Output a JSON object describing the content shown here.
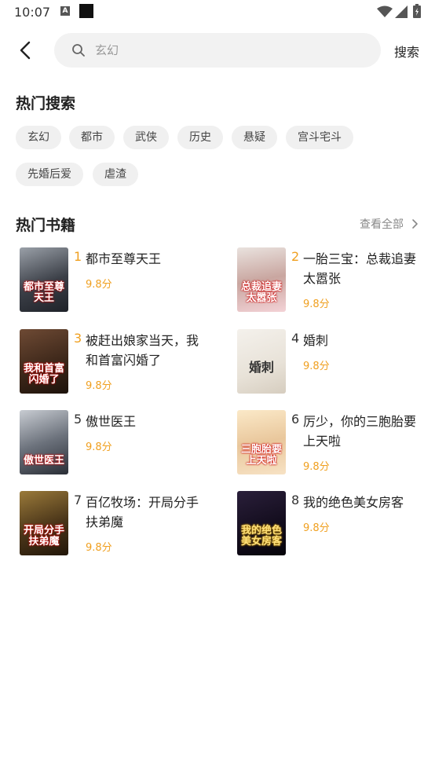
{
  "status_bar": {
    "time": "10:07",
    "notif_icon_letter": "A"
  },
  "header": {
    "search_placeholder": "玄幻",
    "search_button": "搜索"
  },
  "hot_search": {
    "title": "热门搜索",
    "tags": [
      "玄幻",
      "都市",
      "武侠",
      "历史",
      "悬疑",
      "宫斗宅斗",
      "先婚后爱",
      "虐渣"
    ]
  },
  "hot_books": {
    "title": "热门书籍",
    "view_all": "查看全部",
    "books": [
      {
        "rank": "1",
        "title": "都市至尊天王",
        "score": "9.8分",
        "cover_text": "都市至尊天王"
      },
      {
        "rank": "2",
        "title": "一胎三宝：总裁追妻太嚣张",
        "score": "9.8分",
        "cover_text": "总裁追妻太嚣张"
      },
      {
        "rank": "3",
        "title": "被赶出娘家当天，我和首富闪婚了",
        "score": "9.8分",
        "cover_text": "我和首富闪婚了"
      },
      {
        "rank": "4",
        "title": "婚刺",
        "score": "9.8分",
        "cover_text": "婚刺"
      },
      {
        "rank": "5",
        "title": "傲世医王",
        "score": "9.8分",
        "cover_text": "傲世医王"
      },
      {
        "rank": "6",
        "title": "厉少，你的三胞胎要上天啦",
        "score": "9.8分",
        "cover_text": "三胞胎要上天啦"
      },
      {
        "rank": "7",
        "title": "百亿牧场：开局分手扶弟魔",
        "score": "9.8分",
        "cover_text": "开局分手扶弟魔"
      },
      {
        "rank": "8",
        "title": "我的绝色美女房客",
        "score": "9.8分",
        "cover_text": "我的绝色美女房客"
      }
    ]
  },
  "colors": {
    "rank_top3": "#f0a020",
    "rank_other": "#333333",
    "score": "#f0a020",
    "tag_bg": "#f0f0f0"
  }
}
